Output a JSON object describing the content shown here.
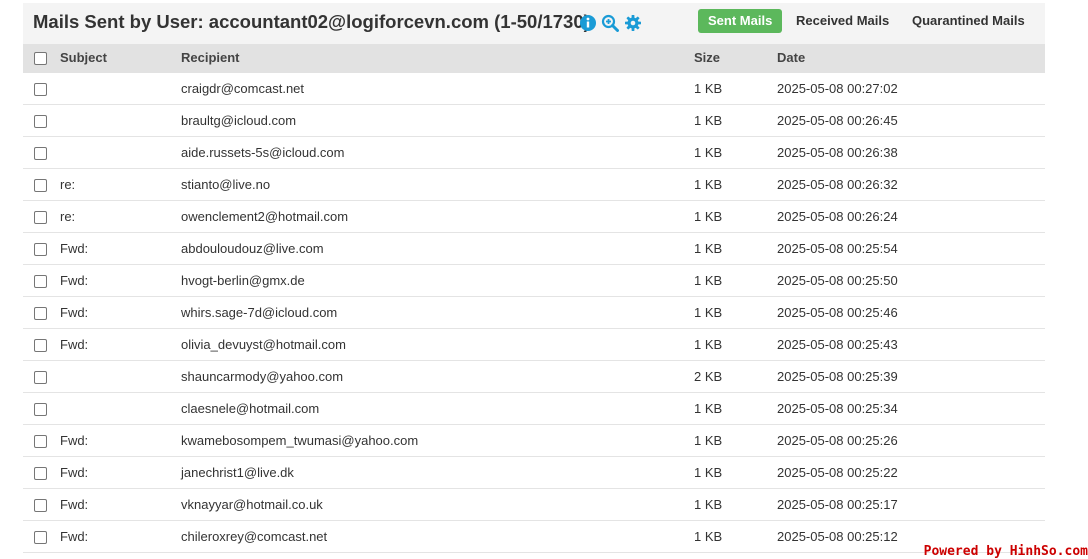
{
  "header": {
    "title": "Mails Sent by User: accountant02@logiforcevn.com (1-50/1730)",
    "icons": [
      "info-icon",
      "zoom-icon",
      "gear-icon"
    ],
    "tabs": [
      {
        "label": "Sent Mails",
        "active": true
      },
      {
        "label": "Received Mails",
        "active": false
      },
      {
        "label": "Quarantined Mails",
        "active": false
      }
    ],
    "accent_color": "#5cb85c",
    "icon_color": "#1a9bd6"
  },
  "table": {
    "columns": [
      "Subject",
      "Recipient",
      "Size",
      "Date"
    ],
    "rows": [
      {
        "subject": "",
        "recipient": "craigdr@comcast.net",
        "size": "1 KB",
        "date": "2025-05-08 00:27:02"
      },
      {
        "subject": "",
        "recipient": "braultg@icloud.com",
        "size": "1 KB",
        "date": "2025-05-08 00:26:45"
      },
      {
        "subject": "",
        "recipient": "aide.russets-5s@icloud.com",
        "size": "1 KB",
        "date": "2025-05-08 00:26:38"
      },
      {
        "subject": "re:",
        "recipient": "stianto@live.no",
        "size": "1 KB",
        "date": "2025-05-08 00:26:32"
      },
      {
        "subject": "re:",
        "recipient": "owenclement2@hotmail.com",
        "size": "1 KB",
        "date": "2025-05-08 00:26:24"
      },
      {
        "subject": "Fwd:",
        "recipient": "abdouloudouz@live.com",
        "size": "1 KB",
        "date": "2025-05-08 00:25:54"
      },
      {
        "subject": "Fwd:",
        "recipient": "hvogt-berlin@gmx.de",
        "size": "1 KB",
        "date": "2025-05-08 00:25:50"
      },
      {
        "subject": "Fwd:",
        "recipient": "whirs.sage-7d@icloud.com",
        "size": "1 KB",
        "date": "2025-05-08 00:25:46"
      },
      {
        "subject": "Fwd:",
        "recipient": "olivia_devuyst@hotmail.com",
        "size": "1 KB",
        "date": "2025-05-08 00:25:43"
      },
      {
        "subject": "",
        "recipient": "shauncarmody@yahoo.com",
        "size": "2 KB",
        "date": "2025-05-08 00:25:39"
      },
      {
        "subject": "",
        "recipient": "claesnele@hotmail.com",
        "size": "1 KB",
        "date": "2025-05-08 00:25:34"
      },
      {
        "subject": "Fwd:",
        "recipient": "kwamebosompem_twumasi@yahoo.com",
        "size": "1 KB",
        "date": "2025-05-08 00:25:26"
      },
      {
        "subject": "Fwd:",
        "recipient": "janechrist1@live.dk",
        "size": "1 KB",
        "date": "2025-05-08 00:25:22"
      },
      {
        "subject": "Fwd:",
        "recipient": "vknayyar@hotmail.co.uk",
        "size": "1 KB",
        "date": "2025-05-08 00:25:17"
      },
      {
        "subject": "Fwd:",
        "recipient": "chileroxrey@comcast.net",
        "size": "1 KB",
        "date": "2025-05-08 00:25:12"
      }
    ]
  },
  "footer": {
    "powered_by": "Powered by HinhSo.com",
    "powered_color": "#cc0000"
  }
}
